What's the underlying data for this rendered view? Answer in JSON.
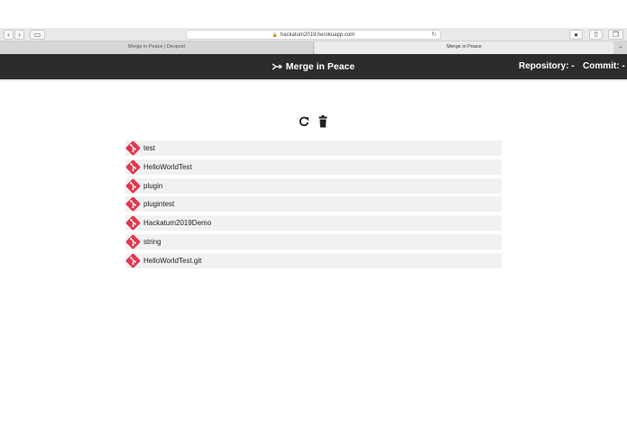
{
  "browser": {
    "url": "hackatum2019.herokuapp.com",
    "tabs": [
      {
        "label": "Merge in Peace | Devpost",
        "active": false
      },
      {
        "label": "Merge in Peace",
        "active": true
      }
    ]
  },
  "app": {
    "title": "Merge in Peace",
    "repository_label": "Repository: -",
    "commit_label": "Commit: -",
    "colors": {
      "header_bg": "#2a2c2e",
      "git_red": "#e4364c",
      "row_bg": "#f1f1f1"
    }
  },
  "actions": [
    {
      "name": "refresh",
      "icon": "refresh-icon"
    },
    {
      "name": "delete",
      "icon": "trash-icon"
    }
  ],
  "repositories": [
    {
      "name": "test"
    },
    {
      "name": "HelloWorldTest"
    },
    {
      "name": "plugin"
    },
    {
      "name": "plugintest"
    },
    {
      "name": "Hackatum2019Demo"
    },
    {
      "name": "string"
    },
    {
      "name": "HelloWorldTest.git"
    }
  ]
}
